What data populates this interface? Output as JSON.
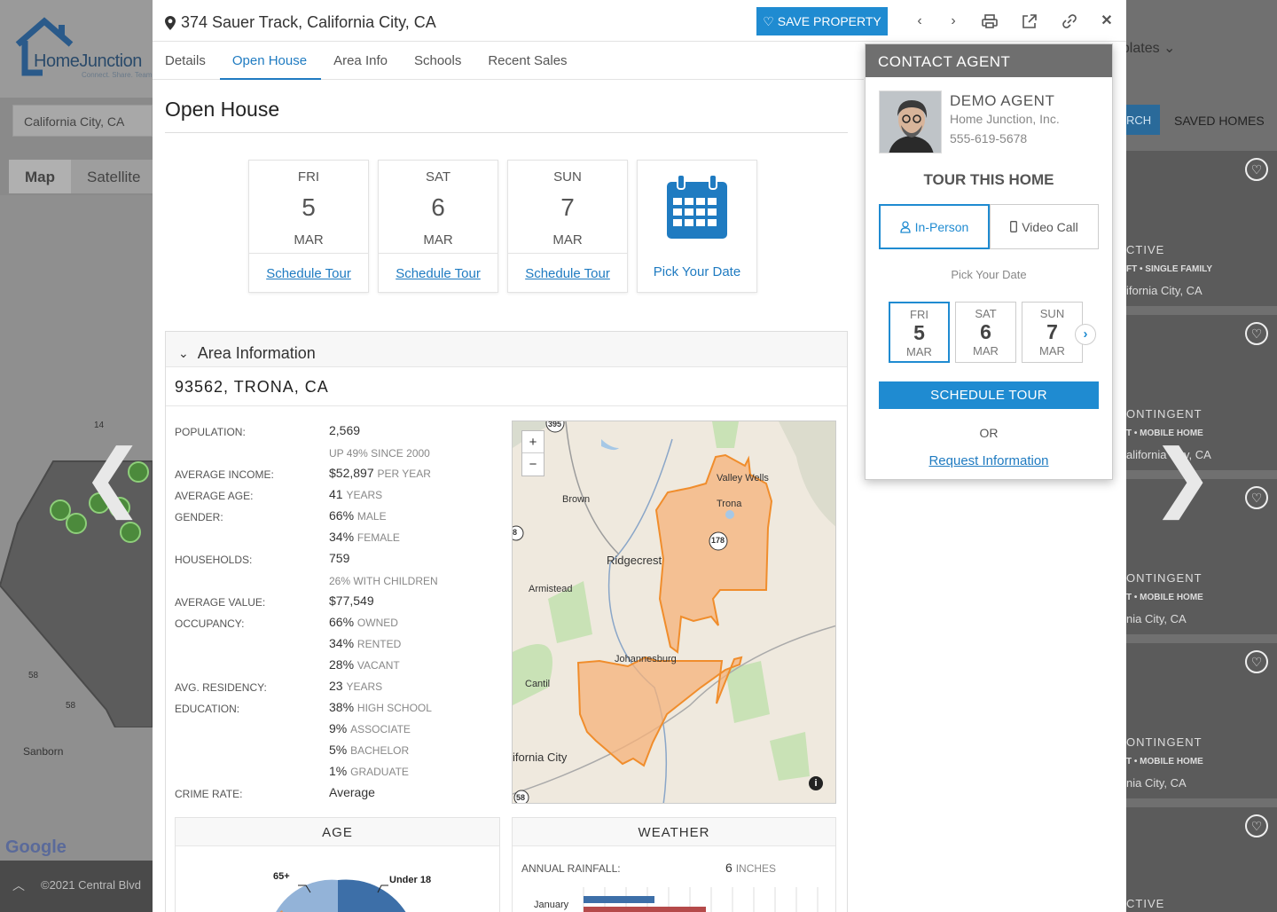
{
  "background": {
    "location_input": "California City, CA",
    "map_tabs": [
      "Map",
      "Satellite"
    ],
    "logo_text": "HomeJunction",
    "logo_tagline": "Connect. Share. Team",
    "map_labels": [
      "Sanborn",
      "14",
      "58",
      "58"
    ],
    "google": "Google",
    "footer": "©2021 Central Blvd",
    "templates_label": "nplates",
    "search_label": "RCH",
    "saved_homes": "SAVED HOMES",
    "cards": [
      {
        "status": "CTIVE",
        "type": "FT • SINGLE FAMILY",
        "city": "ifornia City, CA"
      },
      {
        "status": "ONTINGENT",
        "type": "T • MOBILE HOME",
        "city": "alifornia City, CA"
      },
      {
        "status": "ONTINGENT",
        "type": "T • MOBILE HOME",
        "city": "nia City, CA"
      },
      {
        "status": "ONTINGENT",
        "type": "T • MOBILE HOME",
        "city": "nia City, CA"
      },
      {
        "status": "CTIVE",
        "type": "",
        "city": ""
      }
    ]
  },
  "header": {
    "address": "374 Sauer Track, California City, CA",
    "save_label": "SAVE PROPERTY"
  },
  "tabs": [
    {
      "label": "Details",
      "active": false
    },
    {
      "label": "Open House",
      "active": true
    },
    {
      "label": "Area Info",
      "active": false
    },
    {
      "label": "Schools",
      "active": false
    },
    {
      "label": "Recent Sales",
      "active": false
    }
  ],
  "open_house": {
    "title": "Open House",
    "dates": [
      {
        "dow": "FRI",
        "day": "5",
        "mon": "MAR",
        "action": "Schedule Tour"
      },
      {
        "dow": "SAT",
        "day": "6",
        "mon": "MAR",
        "action": "Schedule Tour"
      },
      {
        "dow": "SUN",
        "day": "7",
        "mon": "MAR",
        "action": "Schedule Tour"
      }
    ],
    "pick_label": "Pick Your Date"
  },
  "area": {
    "heading": "Area Information",
    "subheading": "93562, TRONA, CA",
    "stats": [
      {
        "label": "POPULATION:",
        "value": "2,569",
        "unit": ""
      },
      {
        "label": "",
        "value": "",
        "unit": "UP 49% SINCE 2000"
      },
      {
        "label": "AVERAGE INCOME:",
        "value": "$52,897",
        "unit": "PER YEAR"
      },
      {
        "label": "AVERAGE AGE:",
        "value": "41",
        "unit": "YEARS"
      },
      {
        "label": "GENDER:",
        "value": "66%",
        "unit": "MALE"
      },
      {
        "label": "",
        "value": "34%",
        "unit": "FEMALE"
      },
      {
        "label": "HOUSEHOLDS:",
        "value": "759",
        "unit": ""
      },
      {
        "label": "",
        "value": "",
        "unit": "26% WITH CHILDREN"
      },
      {
        "label": "AVERAGE VALUE:",
        "value": "$77,549",
        "unit": ""
      },
      {
        "label": "OCCUPANCY:",
        "value": "66%",
        "unit": "OWNED"
      },
      {
        "label": "",
        "value": "34%",
        "unit": "RENTED"
      },
      {
        "label": "",
        "value": "28%",
        "unit": "VACANT"
      },
      {
        "label": "AVG. RESIDENCY:",
        "value": "23",
        "unit": "YEARS"
      },
      {
        "label": "EDUCATION:",
        "value": "38%",
        "unit": "HIGH SCHOOL"
      },
      {
        "label": "",
        "value": "9%",
        "unit": "ASSOCIATE"
      },
      {
        "label": "",
        "value": "5%",
        "unit": "BACHELOR"
      },
      {
        "label": "",
        "value": "1%",
        "unit": "GRADUATE"
      },
      {
        "label": "CRIME RATE:",
        "value": "Average",
        "unit": ""
      }
    ],
    "map_labels": {
      "valley_wells": "Valley Wells",
      "trona": "Trona",
      "brown": "Brown",
      "ridgecrest": "Ridgecrest",
      "armistead": "Armistead",
      "johannesburg": "Johannesburg",
      "cantil": "Cantil",
      "california_city": "ifornia City",
      "route_395": "395",
      "route_178": "178",
      "route_58": "58",
      "route_8": "8"
    },
    "age_panel": {
      "title": "AGE",
      "label_65": "65+",
      "label_under18": "Under 18"
    },
    "weather_panel": {
      "title": "WEATHER",
      "rain_label": "ANNUAL RAINFALL:",
      "rain_value": "6",
      "rain_unit": "INCHES",
      "month": "January"
    }
  },
  "contact": {
    "heading": "CONTACT AGENT",
    "agent_name": "DEMO AGENT",
    "company": "Home Junction, Inc.",
    "phone": "555-619-5678",
    "tour_title": "TOUR THIS HOME",
    "in_person": "In-Person",
    "video_call": "Video Call",
    "pick_date": "Pick Your Date",
    "dates": [
      {
        "dow": "FRI",
        "day": "5",
        "mon": "MAR"
      },
      {
        "dow": "SAT",
        "day": "6",
        "mon": "MAR"
      },
      {
        "dow": "SUN",
        "day": "7",
        "mon": "MAR"
      }
    ],
    "schedule_label": "SCHEDULE TOUR",
    "or": "OR",
    "request": "Request Information"
  },
  "colors": {
    "accent": "#1f8bd1",
    "link": "#1f7bc1",
    "map_overlay": "#f6b27a"
  }
}
